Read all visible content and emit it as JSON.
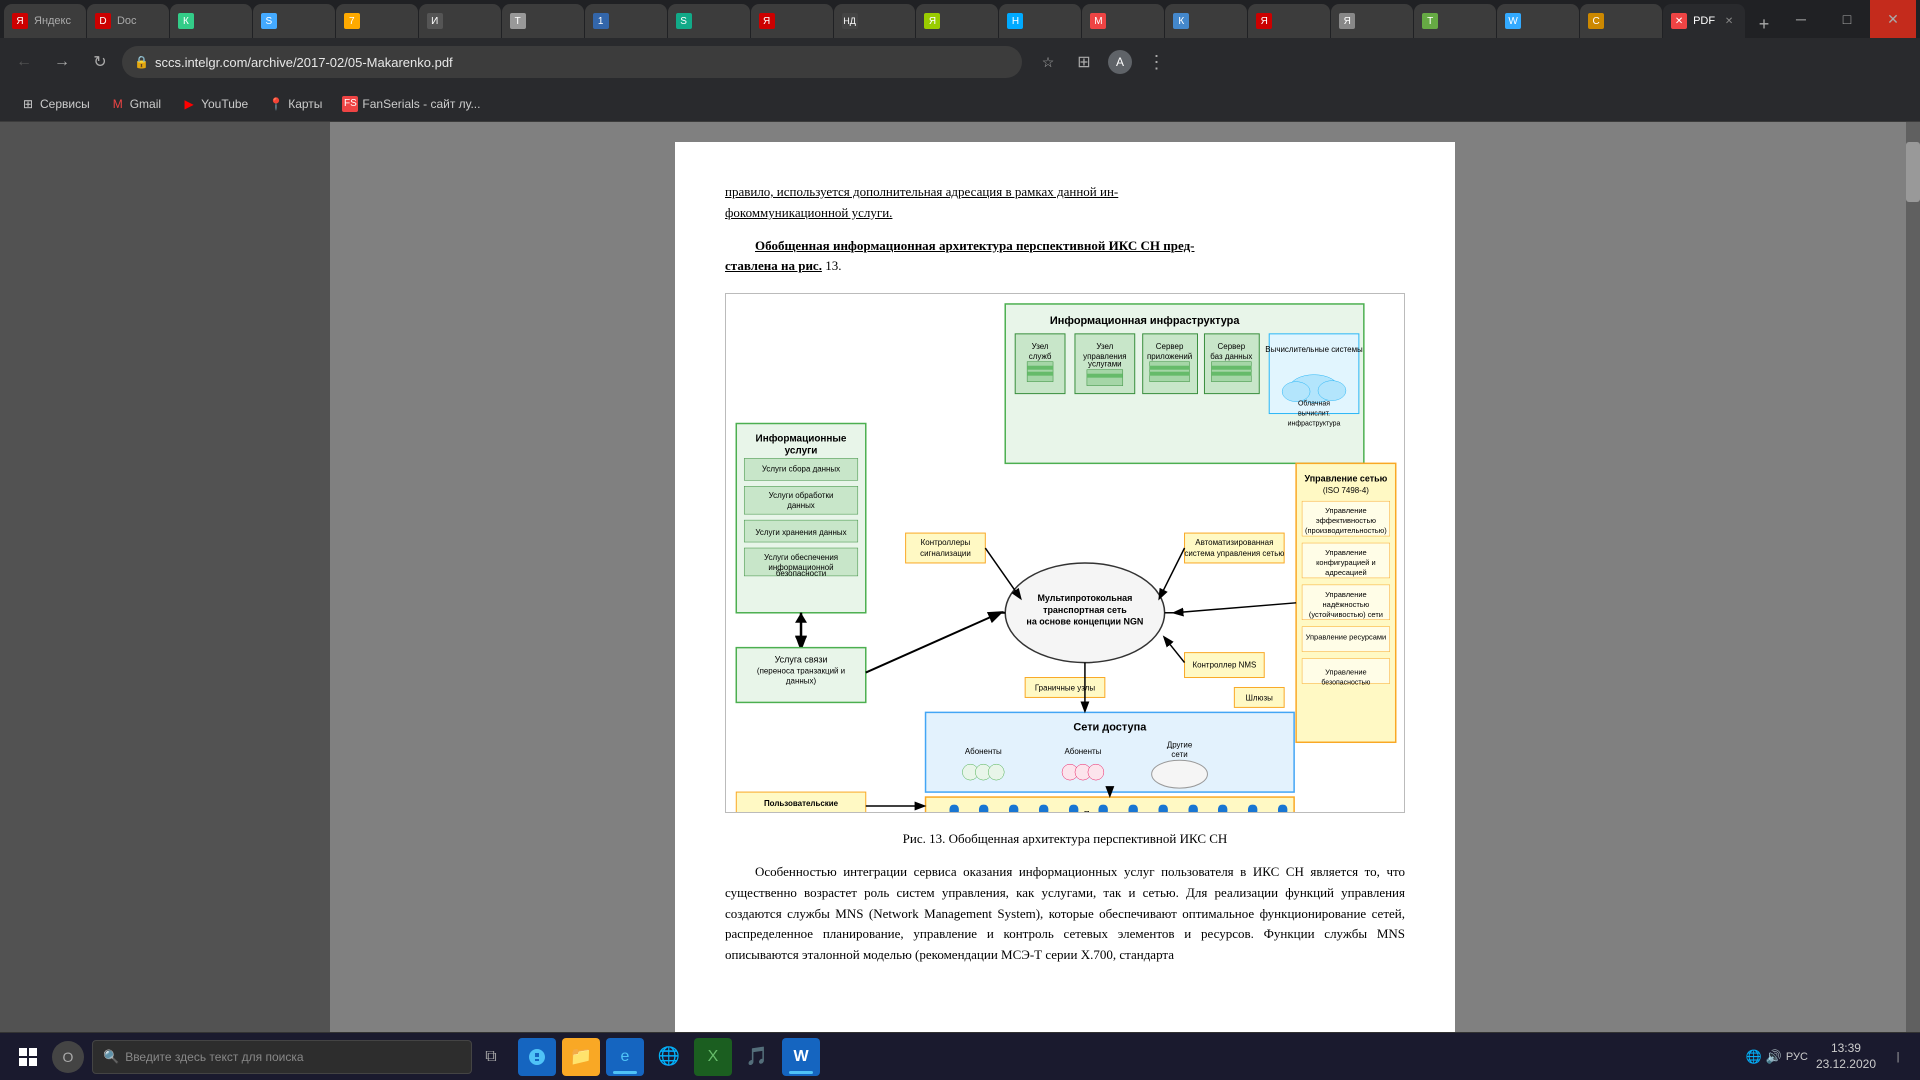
{
  "tabs": [
    {
      "label": "Я",
      "favicon": "Я",
      "active": false
    },
    {
      "label": "D",
      "favicon": "D",
      "active": false
    },
    {
      "label": "К",
      "favicon": "К",
      "active": false
    },
    {
      "label": "S",
      "favicon": "S",
      "active": false
    },
    {
      "label": "7",
      "favicon": "7",
      "active": false
    },
    {
      "label": "И",
      "favicon": "И",
      "active": false
    },
    {
      "label": "Т",
      "favicon": "Т",
      "active": false
    },
    {
      "label": "1",
      "favicon": "1",
      "active": false
    },
    {
      "label": "S",
      "favicon": "S",
      "active": false
    },
    {
      "label": "Я",
      "favicon": "Я",
      "active": false
    },
    {
      "label": "НД",
      "favicon": "НД",
      "active": false
    },
    {
      "label": "Я",
      "favicon": "Я",
      "active": false
    },
    {
      "label": "Н",
      "favicon": "Н",
      "active": false
    },
    {
      "label": "М",
      "favicon": "М",
      "active": false
    },
    {
      "label": "К",
      "favicon": "К",
      "active": false
    },
    {
      "label": "Я",
      "favicon": "Я",
      "active": false
    },
    {
      "label": "Я",
      "favicon": "Я",
      "active": false
    },
    {
      "label": "Т",
      "favicon": "Т",
      "active": false
    },
    {
      "label": "W",
      "favicon": "W",
      "active": false
    },
    {
      "label": "С",
      "favicon": "С",
      "active": false
    },
    {
      "label": "✕",
      "favicon": "✕",
      "active": true
    }
  ],
  "address_bar": {
    "url": "sccs.intelgr.com/archive/2017-02/05-Makarenko.pdf"
  },
  "bookmarks": [
    {
      "label": "Сервисы",
      "icon": "⊞"
    },
    {
      "label": "Gmail",
      "icon": "M"
    },
    {
      "label": "YouTube",
      "icon": "▶"
    },
    {
      "label": "Карты",
      "icon": "📍"
    },
    {
      "label": "FanSerials - сайт лу...",
      "icon": "F"
    }
  ],
  "pdf": {
    "para1": "правило, используется дополнительная адресация в рамках данной инфокоммуникационной услуги.",
    "para2": "Обобщенная информационная архитектура перспективной ИКС СН представлена на рис. 13.",
    "caption": "Рис. 13. Обобщенная архитектура перспективной ИКС СН",
    "para3": "Особенностью интеграции сервиса оказания информационных услуг пользователя в ИКС СН является то, что существенно возрастет роль систем управления, как услугами, так и сетью. Для реализации функций управления создаются службы MNS (Network Management System), которые обеспечивают оптимальное функционирование сетей, распределенное планирование, управление и контроль сетевых элементов и ресурсов. Функции службы MNS описываются эталонной моделью (рекомендации МСЭ-Т серии X.700, стандарта"
  },
  "taskbar": {
    "search_placeholder": "Введите здесь текст для поиска",
    "time": "13:39",
    "date": "23.12.2020",
    "lang": "РУС"
  }
}
